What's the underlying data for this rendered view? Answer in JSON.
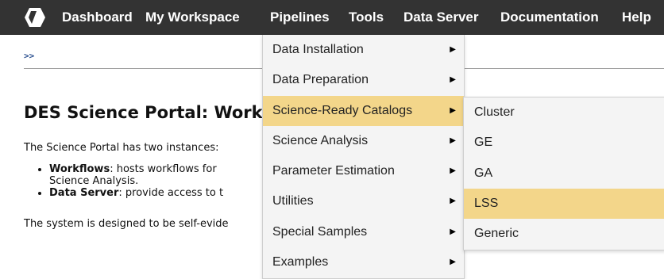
{
  "nav": {
    "logo_icon": "des-hexagon-logo-icon",
    "items": [
      {
        "label": "Dashboard"
      },
      {
        "label": "My Workspace"
      },
      {
        "label": "Pipelines"
      },
      {
        "label": "Tools"
      },
      {
        "label": "Data Server"
      },
      {
        "label": "Documentation"
      },
      {
        "label": "Help"
      }
    ]
  },
  "breadcrumb": ">>",
  "main": {
    "title": "DES Science Portal: Work",
    "intro": "The Science Portal has two instances:",
    "bullets": [
      {
        "bold": "Workflows",
        "text": ": hosts workflows for",
        "cont": "Science Analysis."
      },
      {
        "bold": "Data Server",
        "text": ": provide access to t"
      }
    ],
    "bottom": "The system is designed to be self-evide"
  },
  "pipelines_menu": {
    "items": [
      {
        "label": "Data Installation",
        "arrow": "▶"
      },
      {
        "label": "Data Preparation",
        "arrow": "▶"
      },
      {
        "label": "Science-Ready Catalogs",
        "arrow": "▶"
      },
      {
        "label": "Science Analysis",
        "arrow": "▶"
      },
      {
        "label": "Parameter Estimation",
        "arrow": "▶"
      },
      {
        "label": "Utilities",
        "arrow": "▶"
      },
      {
        "label": "Special Samples",
        "arrow": "▶"
      },
      {
        "label": "Examples",
        "arrow": "▶"
      }
    ],
    "active_index": 2
  },
  "catalogs_submenu": {
    "items": [
      {
        "label": "Cluster"
      },
      {
        "label": "GE"
      },
      {
        "label": "GA"
      },
      {
        "label": "LSS"
      },
      {
        "label": "Generic"
      }
    ],
    "active_index": 3
  },
  "colors": {
    "navbar_bg": "#333333",
    "menu_bg": "#f4f4f4",
    "menu_highlight": "#f3d68a",
    "breadcrumb": "#2a4f8f"
  }
}
